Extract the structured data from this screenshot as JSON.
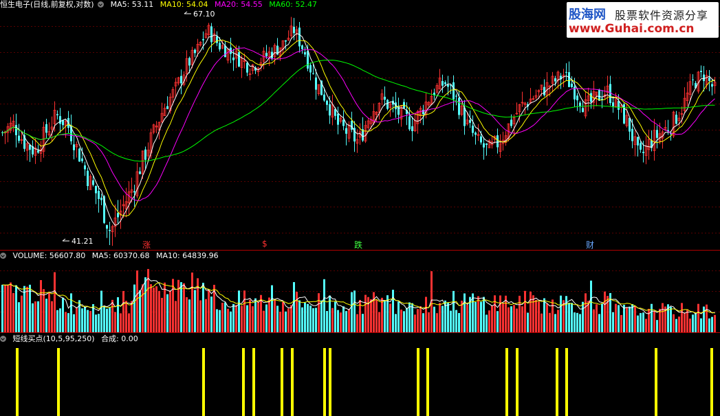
{
  "main_header": {
    "stock": "恒生电子(日线,前复权,对数)",
    "ma5": "MA5: 53.11",
    "ma10": "MA10: 54.04",
    "ma20": "MA20: 54.55",
    "ma60": "MA60: 52.47"
  },
  "volume_header": {
    "volume": "VOLUME: 56607.80",
    "ma5": "MA5: 60370.68",
    "ma10": "MA10: 64839.96"
  },
  "indicator_header": {
    "name": "短线买点(10,5,95,250)",
    "value": "合成: 0.00"
  },
  "watermark": {
    "site": "股海网",
    "tagline": "股票软件资源分享",
    "url": "www.Guhai.com.cn"
  },
  "annotations": {
    "high": "67.10",
    "low": "41.21"
  },
  "signals": [
    {
      "text": "涨",
      "color": "#ff3030"
    },
    {
      "text": "$",
      "color": "#ff3030"
    },
    {
      "text": "跌",
      "color": "#40ff40"
    },
    {
      "text": "财",
      "color": "#6aa8ff"
    }
  ],
  "colors": {
    "up": "#ff3232",
    "down": "#54ffff",
    "ma5": "#ffffff",
    "ma10": "#ffff00",
    "ma20": "#ff00ff",
    "ma60": "#00ff00",
    "buy_signal": "#ffff00"
  },
  "chart_data": {
    "type": "candlestick",
    "price_range": [
      41.21,
      67.1
    ],
    "high": 67.1,
    "low": 41.21,
    "price_path": [
      52,
      53,
      51,
      50,
      52,
      54,
      53,
      50,
      47,
      45,
      42,
      44,
      46,
      49,
      52,
      55,
      57,
      60,
      62,
      65,
      63,
      62,
      61,
      60,
      61,
      62,
      63,
      65,
      62,
      58,
      56,
      53,
      52,
      51,
      54,
      56,
      55,
      54,
      53,
      55,
      57,
      58,
      56,
      53,
      51,
      50,
      51,
      53,
      55,
      56,
      57,
      58,
      59,
      57,
      55,
      56,
      57,
      55,
      53,
      49,
      51,
      52,
      53,
      55,
      58,
      59,
      57
    ],
    "signal_positions": [
      0.024,
      0.081,
      0.283,
      0.338,
      0.352,
      0.392,
      0.406,
      0.451,
      0.458,
      0.581,
      0.594,
      0.704,
      0.718,
      0.774,
      0.787,
      0.911,
      0.989
    ],
    "series": [
      {
        "name": "MA5",
        "value": 53.11
      },
      {
        "name": "MA10",
        "value": 54.04
      },
      {
        "name": "MA20",
        "value": 54.55
      },
      {
        "name": "MA60",
        "value": 52.47
      },
      {
        "name": "VOLUME",
        "value": 56607.8
      },
      {
        "name": "VOL MA5",
        "value": 60370.68
      },
      {
        "name": "VOL MA10",
        "value": 64839.96
      }
    ]
  }
}
